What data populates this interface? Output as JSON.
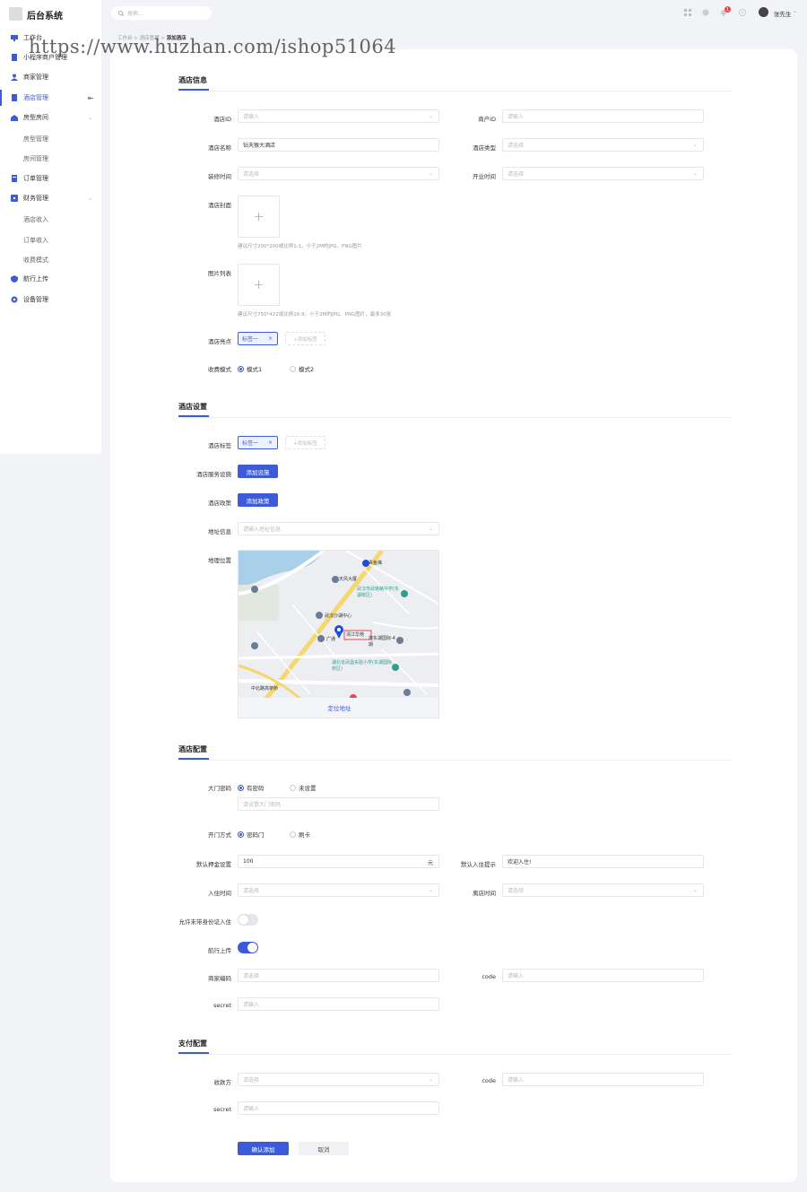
{
  "app": {
    "title": "后台系统"
  },
  "search": {
    "placeholder": "搜索..."
  },
  "user": {
    "name": "张先生",
    "notification_count": "1"
  },
  "breadcrumb": {
    "items": [
      "工作台",
      "酒店管理",
      "添加酒店"
    ]
  },
  "watermark": "https://www.huzhan.com/ishop51064",
  "sidebar": {
    "items": [
      {
        "label": "工作台"
      },
      {
        "label": "小程序商户管理"
      },
      {
        "label": "商家管理"
      },
      {
        "label": "酒店管理"
      },
      {
        "label": "房型房间"
      },
      {
        "label": "房型管理"
      },
      {
        "label": "房间管理"
      },
      {
        "label": "订单管理"
      },
      {
        "label": "财务管理"
      },
      {
        "label": "酒店收入"
      },
      {
        "label": "订单收入"
      },
      {
        "label": "收费模式"
      },
      {
        "label": "航行上传"
      },
      {
        "label": "设备管理"
      }
    ]
  },
  "hotel_info": {
    "title": "酒店信息",
    "hotel_id": {
      "label": "酒店ID",
      "placeholder": "请输入"
    },
    "merchant_id": {
      "label": "商户ID",
      "placeholder": "请输入"
    },
    "hotel_name": {
      "label": "酒店名称",
      "value": "钻天猴大酒店"
    },
    "hotel_type": {
      "label": "酒店类型",
      "placeholder": "请选择"
    },
    "renovation_time": {
      "label": "装修时间",
      "placeholder": "请选择"
    },
    "opening_time": {
      "label": "开业时间",
      "placeholder": "请选择"
    },
    "cover": {
      "label": "酒店封面",
      "hint": "建议尺寸200*200或比例1:1，小于2M的JPG、PNG图片"
    },
    "images": {
      "label": "图片列表",
      "hint": "建议尺寸750*422或比例16:9，小于2M的JPG、PNG图片，最多30张"
    },
    "highlights": {
      "label": "酒店亮点",
      "tag": "标签一",
      "add": "+添加标签"
    },
    "charge_mode": {
      "label": "收费模式",
      "options": [
        "模式1",
        "模式2"
      ]
    }
  },
  "hotel_settings": {
    "title": "酒店设置",
    "tags": {
      "label": "酒店标签",
      "tag": "标签一",
      "add": "+添加标签"
    },
    "services": {
      "label": "酒店服务设施",
      "button": "添加设施"
    },
    "policy": {
      "label": "酒店政策",
      "button": "添加政策"
    },
    "address": {
      "label": "地址信息",
      "placeholder": "请输入地址信息"
    },
    "location": {
      "label": "地理位置",
      "locate": "定位地址"
    }
  },
  "map": {
    "labels": [
      "青鱼嘴",
      "天风大厦",
      "武汉市武珞路中学(东湖校区)",
      "武汉沙湖中心",
      "清江华苑",
      "地东湖国际-4期",
      "湖北省武昌实验小学(东湖国际校区)",
      "中北路高架桥",
      "广通"
    ]
  },
  "hotel_config": {
    "title": "酒店配置",
    "door_password": {
      "label": "大门密码",
      "options": [
        "有密码",
        "未设置"
      ],
      "placeholder": "请设置大门密码"
    },
    "open_method": {
      "label": "开门方式",
      "options": [
        "密码门",
        "刷卡"
      ]
    },
    "deposit": {
      "label": "默认押金设置",
      "value": "100",
      "unit": "元"
    },
    "checkin_tip": {
      "label": "默认入住提示",
      "value": "欢迎入住!"
    },
    "checkin_time": {
      "label": "入住时间",
      "placeholder": "请选择"
    },
    "checkout_time": {
      "label": "离店时间",
      "placeholder": "请选择"
    },
    "allow_no_id": {
      "label": "允许未带身份证入住",
      "on": false
    },
    "flight_upload": {
      "label": "航行上传",
      "on": true
    },
    "merchant_code": {
      "label": "商家编码",
      "placeholder": "请选择"
    },
    "code": {
      "label": "code",
      "placeholder": "请输入"
    },
    "secret": {
      "label": "secret",
      "placeholder": "请输入"
    }
  },
  "payment_config": {
    "title": "支付配置",
    "payee": {
      "label": "收款方",
      "placeholder": "请选择"
    },
    "code": {
      "label": "code",
      "placeholder": "请输入"
    },
    "secret": {
      "label": "secret",
      "placeholder": "请输入"
    }
  },
  "actions": {
    "confirm": "确认添加",
    "cancel": "取消"
  },
  "colors": {
    "accent": "#3b5bdb",
    "background": "#f2f3f7"
  }
}
